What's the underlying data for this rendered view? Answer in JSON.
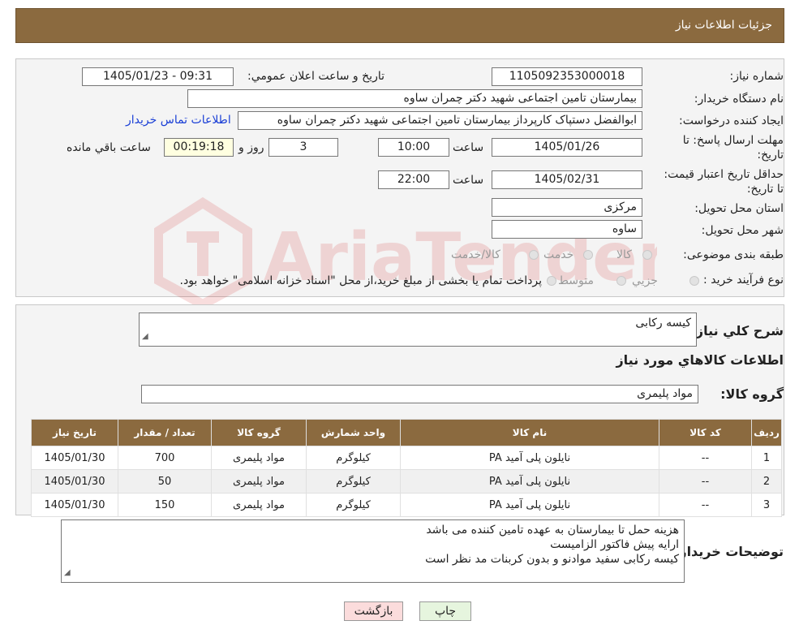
{
  "page_title": "جزئیات اطلاعات نیاز",
  "form": {
    "need_number_label": "شماره نیاز:",
    "need_number": "1105092353000018",
    "announce_label": "تاریخ و ساعت اعلان عمومي:",
    "announce_value": "1405/01/23 - 09:31",
    "buyer_label": "نام دستگاه خريدار:",
    "buyer_value": "بیمارستان تامین اجتماعی شهید دکتر چمران ساوه",
    "creator_label": "ايجاد كننده درخواست:",
    "creator_value": "ابوالفضل  دستپاک  کارپرداز بیمارستان تامین اجتماعی شهید دکتر چمران ساوه",
    "contact_link": "اطلاعات تماس خريدار",
    "reply_deadline_label": "مهلت ارسال پاسخ: تا تاريخ:",
    "reply_date": "1405/01/26",
    "time_label": "ساعت",
    "reply_time": "10:00",
    "days_value": "3",
    "days_label": "روز و",
    "remaining_time": "00:19:18",
    "remaining_label": "ساعت باقي مانده",
    "price_validity_label": "حداقل تاريخ اعتبار قيمت: تا تاريخ:",
    "price_date": "1405/02/31",
    "price_time": "22:00",
    "province_label": "استان محل تحويل:",
    "province_value": "مرکزی",
    "city_label": "شهر محل تحويل:",
    "city_value": "ساوه",
    "category_label": "طبقه بندی موضوعی:",
    "category_options": [
      "کالا",
      "خدمت",
      "کالا/خدمت"
    ],
    "process_label": "نوع فرآيند خريد :",
    "process_options": [
      "جزيي",
      "متوسط"
    ],
    "process_note": "پرداخت تمام يا بخشی از مبلغ خريد،از محل \"اسناد خزانه اسلامی\" خواهد بود."
  },
  "description": {
    "label": "شرح كلي نياز:",
    "value": "کیسه رکابی",
    "goods_info_title": "اطلاعات كالاهاي مورد نياز",
    "group_label": "گروه كالا:",
    "group_value": "مواد پلیمری"
  },
  "table": {
    "headers": [
      "رديف",
      "كد كالا",
      "نام كالا",
      "واحد شمارش",
      "گروه كالا",
      "تعداد / مقدار",
      "تاريخ نياز"
    ],
    "rows": [
      {
        "idx": "1",
        "code": "--",
        "name": "نایلون پلی آمید PA",
        "unit": "کیلوگرم",
        "group": "مواد پلیمری",
        "qty": "700",
        "date": "1405/01/30"
      },
      {
        "idx": "2",
        "code": "--",
        "name": "نایلون پلی آمید PA",
        "unit": "کیلوگرم",
        "group": "مواد پلیمری",
        "qty": "50",
        "date": "1405/01/30"
      },
      {
        "idx": "3",
        "code": "--",
        "name": "نایلون پلی آمید PA",
        "unit": "کیلوگرم",
        "group": "مواد پلیمری",
        "qty": "150",
        "date": "1405/01/30"
      }
    ]
  },
  "buyer_notes": {
    "label": "توضيحات خريدار:",
    "lines": [
      "هزینه حمل تا بیمارستان به عهده تامین کننده می باشد",
      "ارایه پیش فاکتور الزامیست",
      "کیسه رکابی سفید موادنو و بدون کربنات مد نظر است"
    ]
  },
  "buttons": {
    "print": "چاپ",
    "back": "بازگشت"
  },
  "watermark": {
    "text": "AriaTender.neT",
    "icon": "ariatender-logo-icon"
  },
  "colors": {
    "header": "#8b6a3f",
    "back_button": "#fbdcdc",
    "print_button": "#e6f5de",
    "link": "#1a3fd6"
  }
}
